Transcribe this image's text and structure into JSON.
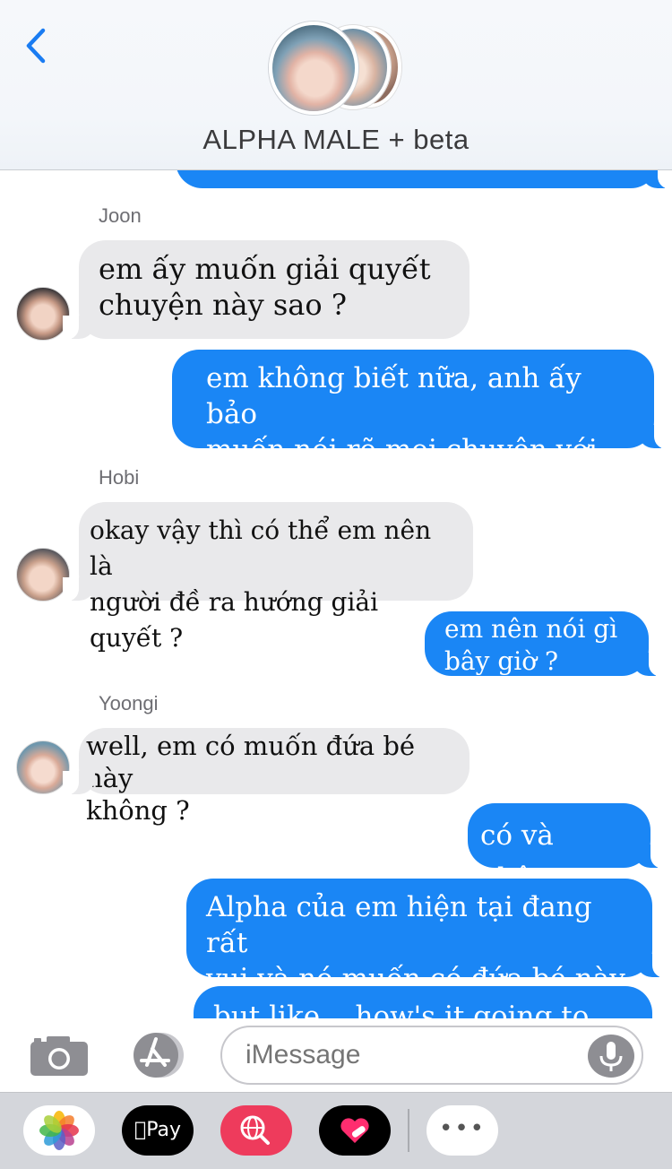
{
  "header": {
    "title": "ALPHA MALE + beta"
  },
  "messages": [
    {
      "kind": "sender",
      "text": "Joon"
    },
    {
      "kind": "incoming",
      "text": "em ấy muốn giải quyết\nchuyện này sao ?"
    },
    {
      "kind": "outgoing",
      "text": "em không biết nữa, anh ấy bảo\nmuốn nói rõ mọi chuyện với em"
    },
    {
      "kind": "sender",
      "text": "Hobi"
    },
    {
      "kind": "incoming",
      "text": "okay vậy thì có thể em nên là\nngười đề ra hướng giải quyết ?"
    },
    {
      "kind": "outgoing",
      "text": "em nên nói gì\nbây giờ ?"
    },
    {
      "kind": "sender",
      "text": "Yoongi"
    },
    {
      "kind": "incoming",
      "text": "well, em có muốn đứa bé này\nkhông ?"
    },
    {
      "kind": "outgoing",
      "text": "có và không"
    },
    {
      "kind": "outgoing",
      "text": "Alpha của em hiện tại đang rất\nvui và nó muốn có đứa bé này"
    },
    {
      "kind": "outgoing",
      "text": "but like... how's it going to work"
    }
  ],
  "composer": {
    "placeholder": "iMessage"
  },
  "drawer": {
    "pay_label": "Pay",
    "more_label": "•••"
  },
  "colors": {
    "outgoing_bubble": "#1a86f5",
    "incoming_bubble": "#e9e9eb",
    "back_chevron": "#1a7cf2"
  }
}
